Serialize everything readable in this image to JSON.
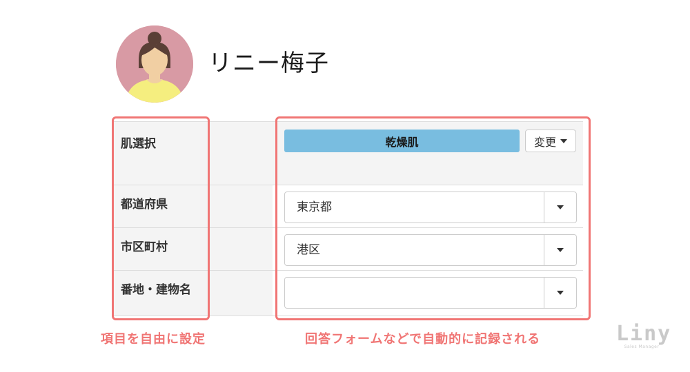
{
  "profile": {
    "name": "リニー梅子"
  },
  "form": {
    "rows": [
      {
        "label": "肌選択",
        "tag": "乾燥肌",
        "change_button": "変更"
      },
      {
        "label": "都道府県",
        "value": "東京都"
      },
      {
        "label": "市区町村",
        "value": "港区"
      },
      {
        "label": "番地・建物名",
        "value": ""
      }
    ]
  },
  "annotations": {
    "left_caption": "項目を自由に設定",
    "right_caption": "回答フォームなどで自動的に記録される"
  },
  "logo": {
    "word": "Liny",
    "tagline": "Sales Manager"
  },
  "colors": {
    "highlight": "#f07574",
    "tag_background": "#79bde0",
    "avatar_background": "#d89aa4",
    "label_background": "#f4f4f4"
  }
}
